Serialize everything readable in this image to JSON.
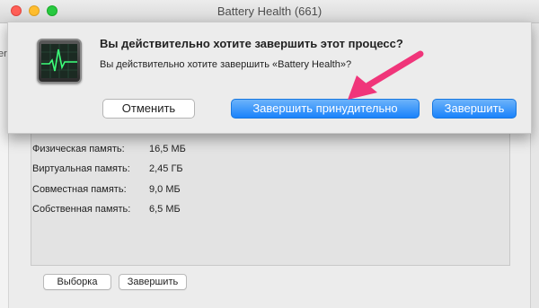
{
  "window": {
    "title": "Battery Health (661)",
    "left_strip_text": "er"
  },
  "alert": {
    "title": "Вы действительно хотите завершить этот процесс?",
    "message": "Вы действительно хотите завершить «Battery Health»?",
    "cancel_label": "Отменить",
    "force_quit_label": "Завершить принудительно",
    "quit_label": "Завершить"
  },
  "memory": [
    {
      "label": "Физическая память:",
      "value": "16,5 МБ"
    },
    {
      "label": "Виртуальная память:",
      "value": "2,45 ГБ"
    },
    {
      "label": "Совместная память:",
      "value": "9,0 МБ"
    },
    {
      "label": "Собственная память:",
      "value": "6,5 МБ"
    }
  ],
  "footer": {
    "sample_label": "Выборка",
    "quit_label": "Завершить"
  },
  "colors": {
    "accent": "#1a82fb",
    "annotation_arrow": "#f0357a"
  },
  "icons": {
    "app": "activity-monitor-icon"
  }
}
